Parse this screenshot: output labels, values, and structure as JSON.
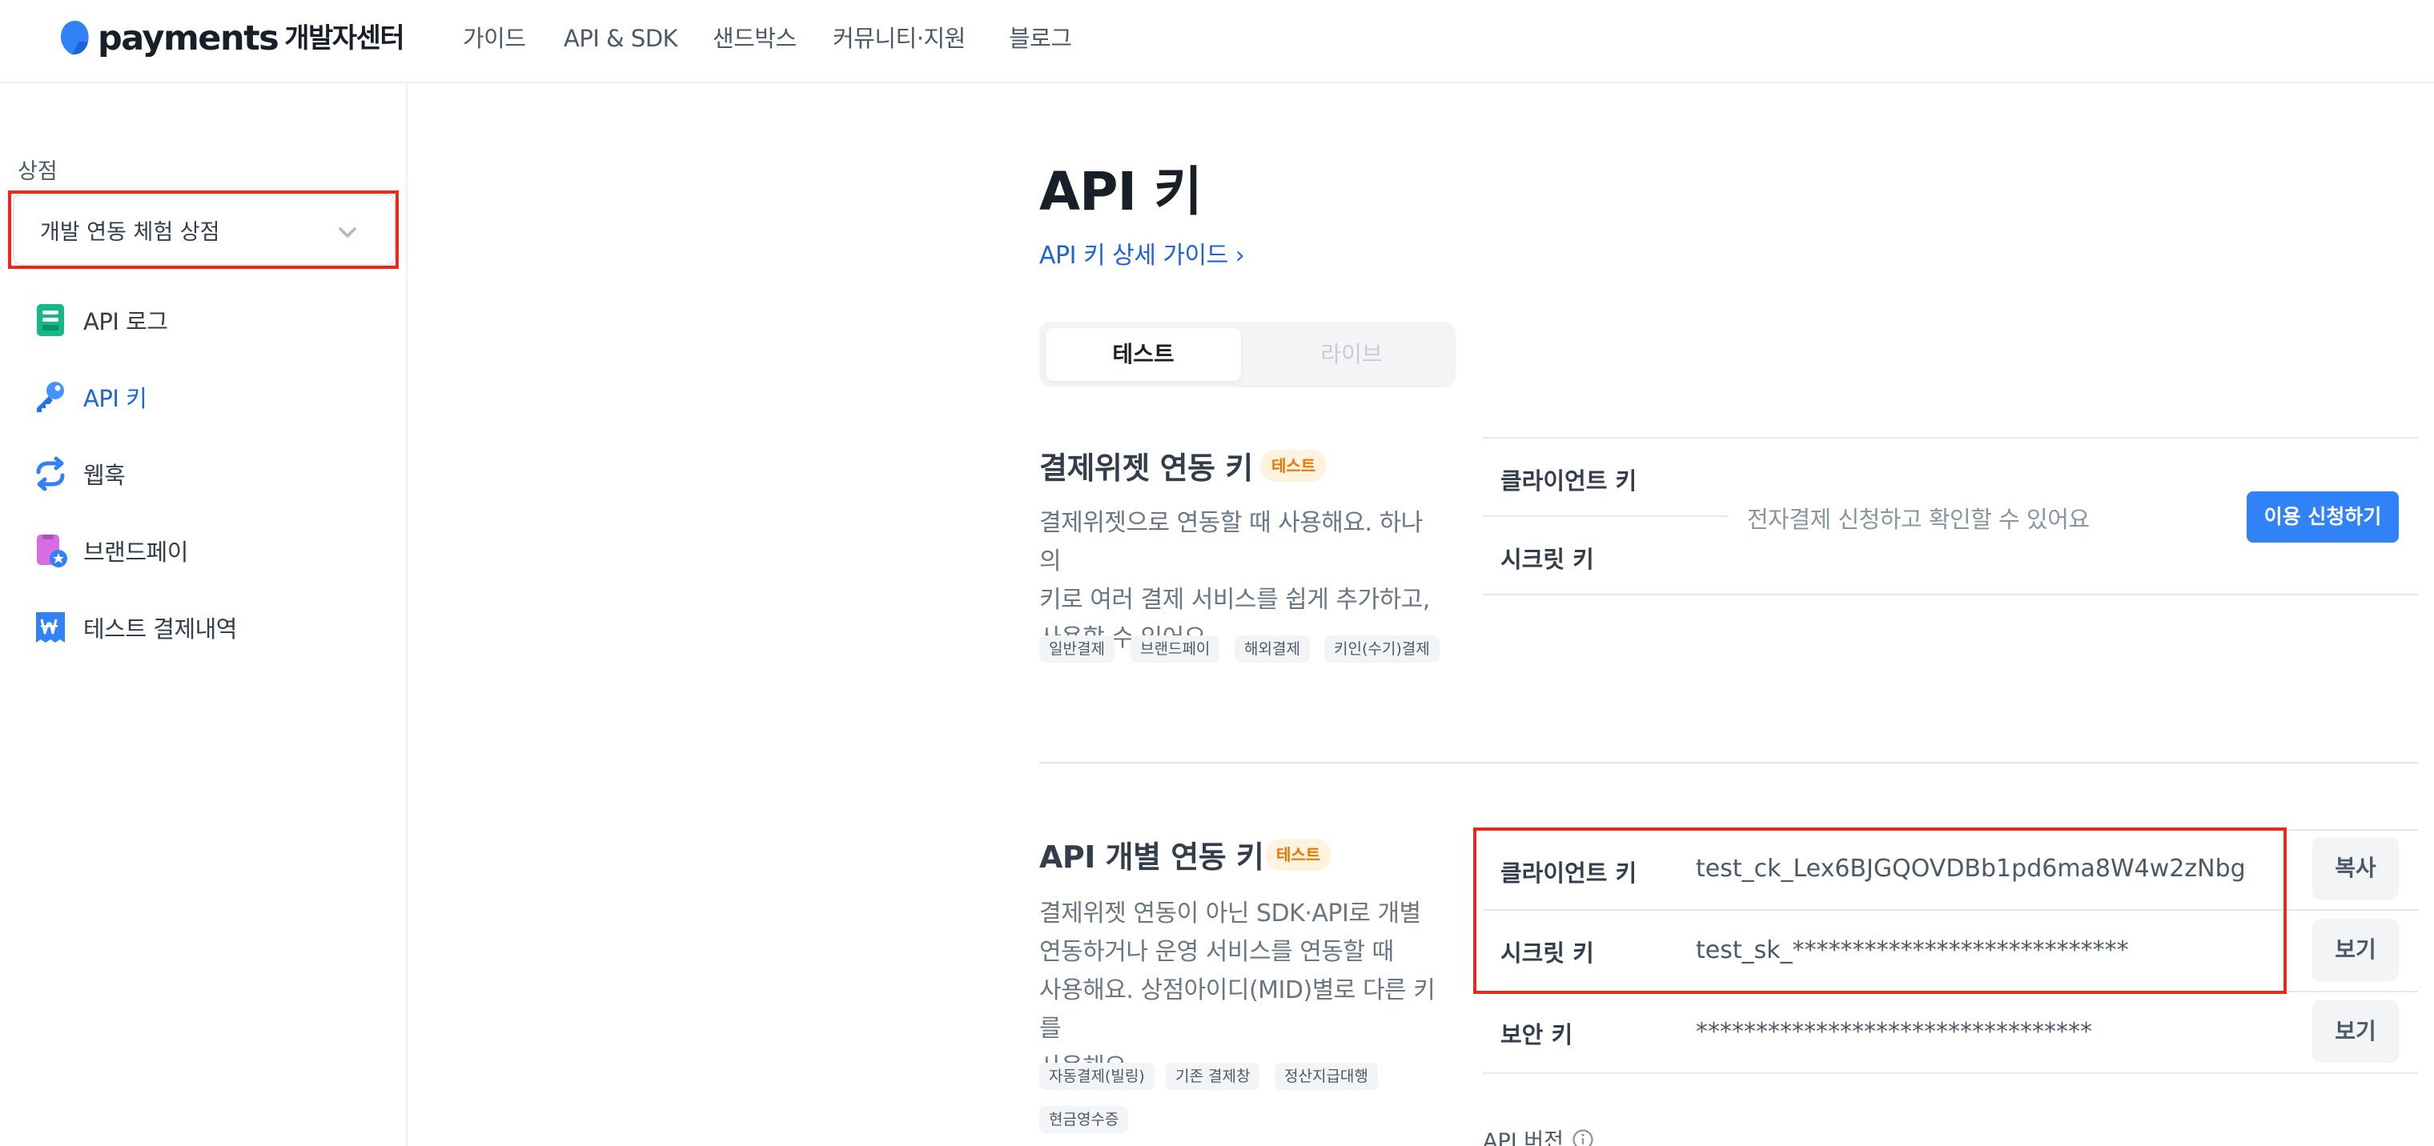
{
  "brand": {
    "wordmark": "payments",
    "subtitle": "개발자센터",
    "logo_color": "#3182f6"
  },
  "topnav": {
    "items": [
      {
        "label": "가이드"
      },
      {
        "label": "API & SDK"
      },
      {
        "label": "샌드박스"
      },
      {
        "label": "커뮤니티·지원"
      },
      {
        "label": "블로그"
      }
    ]
  },
  "sidebar": {
    "store_label": "상점",
    "store_select_value": "개발 연동 체험 상점",
    "items": [
      {
        "label": "API 로그",
        "icon": "document-icon",
        "active": false
      },
      {
        "label": "API 키",
        "icon": "key-icon",
        "active": true
      },
      {
        "label": "웹훅",
        "icon": "sync-arrows-icon",
        "active": false
      },
      {
        "label": "브랜드페이",
        "icon": "brandpay-card-icon",
        "active": false
      },
      {
        "label": "테스트 결제내역",
        "icon": "won-receipt-icon",
        "active": false
      }
    ]
  },
  "main": {
    "title": "API 키",
    "guide_link": "API 키 상세 가이드 ›",
    "mode_tabs": [
      {
        "label": "테스트",
        "selected": true
      },
      {
        "label": "라이브",
        "selected": false
      }
    ],
    "widget_section": {
      "title": "결제위젯 연동 키",
      "badge": "테스트",
      "desc_lines": [
        "결제위젯으로 연동할 때 사용해요. 하나의",
        "키로 여러 결제 서비스를 쉽게 추가하고,",
        "사용할 수 있어요."
      ],
      "tags": [
        "일반결제",
        "브랜드페이",
        "해외결제",
        "키인(수기)결제"
      ],
      "client_key_label": "클라이언트 키",
      "secret_key_label": "시크릿 키",
      "hint": "전자결제 신청하고 확인할 수 있어요",
      "apply_button": "이용 신청하기"
    },
    "individual_section": {
      "title": "API 개별 연동 키",
      "badge": "테스트",
      "desc_lines": [
        "결제위젯 연동이 아닌 SDK·API로 개별",
        "연동하거나 운영 서비스를 연동할 때",
        "사용해요. 상점아이디(MID)별로 다른 키를",
        "사용해요."
      ],
      "tags": [
        "자동결제(빌링)",
        "기존 결제창",
        "정산지급대행",
        "현금영수증"
      ],
      "keys": [
        {
          "label": "클라이언트 키",
          "value": "test_ck_Lex6BJGQOVDBb1pd6ma8W4w2zNbg",
          "button": "복사"
        },
        {
          "label": "시크릿 키",
          "value": "test_sk_****************************",
          "button": "보기"
        },
        {
          "label": "보안 키",
          "value": "*********************************",
          "button": "보기"
        }
      ],
      "api_version_label": "API 버전"
    }
  },
  "colors": {
    "primary": "#3182f6",
    "link": "#1b64da",
    "highlight": "#e8291e",
    "badge_bg": "#fff3e0",
    "badge_text": "#e67700"
  }
}
